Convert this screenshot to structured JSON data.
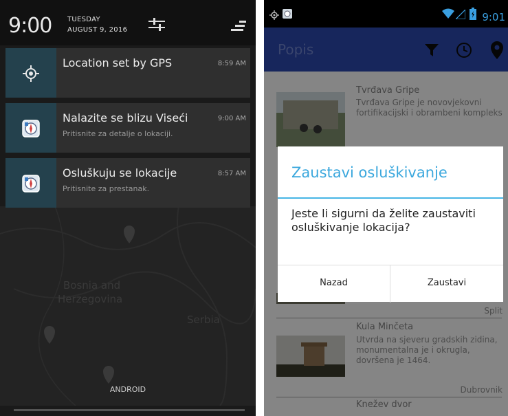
{
  "left": {
    "clock": "9:00",
    "day": "TUESDAY",
    "date": "AUGUST 9, 2016",
    "notifications": [
      {
        "title": "Location set by GPS",
        "subtitle": "",
        "time": "8:59 AM",
        "icon": "gps-target-icon"
      },
      {
        "title": "Nalazite se blizu Viseći",
        "subtitle": "Pritisnite za detalje o lokaciji.",
        "time": "9:00 AM",
        "icon": "app-compass-icon"
      },
      {
        "title": "Osluškuju se lokacije",
        "subtitle": "Pritisnite za prestanak.",
        "time": "8:57 AM",
        "icon": "app-compass-icon"
      }
    ],
    "map_labels": [
      "Bosnia and",
      "Herzegovina",
      "Serbia"
    ],
    "carrier": "ANDROID"
  },
  "right": {
    "status_time": "9:01",
    "app_title": "Popis",
    "list": [
      {
        "title": "Tvrđava Gripe",
        "desc": "Tvrđava Gripe je novovjekovni fortifikacijski i obrambeni kompleks",
        "city": ""
      },
      {
        "title": "",
        "desc": "",
        "city": "Split"
      },
      {
        "title": "Kula Minčeta",
        "desc": "Utvrda na sjeveru gradskih zidina, monumentalna je i okrugla, dovršena je 1464.",
        "city": "Dubrovnik"
      },
      {
        "title": "Knežev dvor",
        "desc": "",
        "city": ""
      }
    ],
    "dialog": {
      "title": "Zaustavi osluškivanje",
      "message": "Jeste li sigurni da želite zaustaviti osluškivanje lokacija?",
      "negative": "Nazad",
      "positive": "Zaustavi"
    }
  },
  "colors": {
    "accent": "#3aa7dd",
    "appbar": "#2a45a8",
    "notif_icon_bg": "#24414d"
  }
}
